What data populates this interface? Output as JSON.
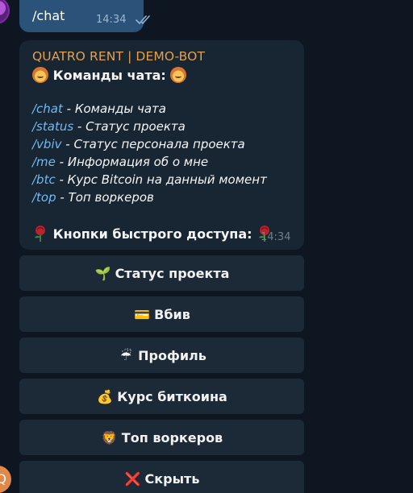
{
  "outgoing": {
    "text": "/chat",
    "time": "14:34",
    "status_icon": "double-check-icon"
  },
  "bot_message": {
    "sender": "QUATRO RENT | DEMO-BOT",
    "heading": "Команды чата:",
    "commands": [
      {
        "cmd": "/chat",
        "desc": " - Команды чата"
      },
      {
        "cmd": "/status",
        "desc": " - Статус проекта"
      },
      {
        "cmd": "/vbiv",
        "desc": " - Статус персонала проекта"
      },
      {
        "cmd": "/me",
        "desc": " - Информация об о мне"
      },
      {
        "cmd": "/btc",
        "desc": " - Курс Bitcoin на данный момент"
      },
      {
        "cmd": "/top",
        "desc": " - Топ воркеров"
      }
    ],
    "quick_access": "Кнопки быстрого доступа:",
    "time": "14:34"
  },
  "keyboard": [
    {
      "label": "Статус проекта",
      "icon": "seedling-icon",
      "glyph": "🌱"
    },
    {
      "label": "Вбив",
      "icon": "card-icon",
      "glyph": "💳"
    },
    {
      "label": "Профиль",
      "icon": "umbrella-icon",
      "glyph": "☔"
    },
    {
      "label": "Курс биткоина",
      "icon": "money-bag-icon",
      "glyph": "💰"
    },
    {
      "label": "Топ воркеров",
      "icon": "lion-icon",
      "glyph": "🦁"
    },
    {
      "label": "Скрыть",
      "icon": "cross-icon",
      "glyph": "❌"
    }
  ],
  "colors": {
    "background": "#0e1621",
    "outgoing_bubble": "#2b5278",
    "incoming_bubble": "#182533",
    "sender_name": "#e6a04d",
    "command_link": "#71baf2",
    "button_bg": "#1c2a38"
  }
}
